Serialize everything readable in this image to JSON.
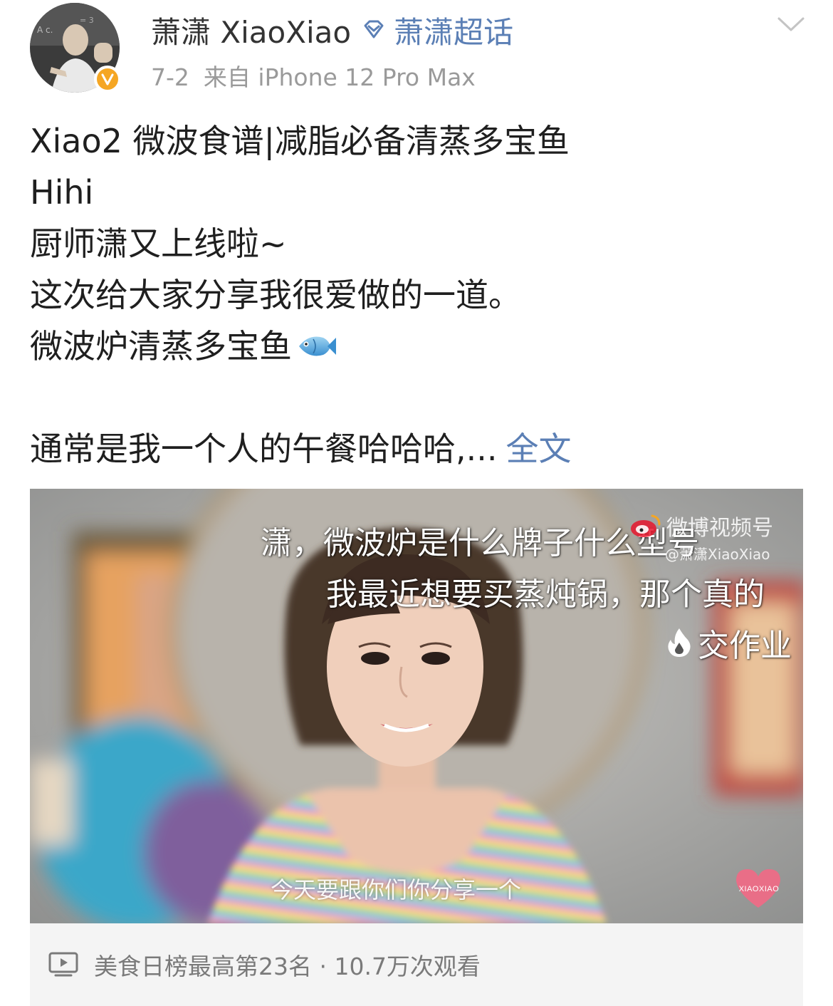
{
  "header": {
    "username": "萧潇 XiaoXiao",
    "supertopic_label": "萧潇超话",
    "date": "7-2",
    "source": "来自 iPhone 12 Pro Max",
    "avatar_icon": "avatar-photo",
    "verified_icon": "verified-v-badge",
    "verified_color": "#f5a623",
    "supertopic_icon": "diamond-icon",
    "link_color": "#5b7fb5"
  },
  "post": {
    "lines": [
      "Xiao2 微波食谱|减脂必备清蒸多宝鱼",
      "Hihi",
      "厨师潇又上线啦~",
      "这次给大家分享我很爱做的一道。",
      "微波炉清蒸多宝鱼"
    ],
    "emoji_icon": "fish-emoji",
    "truncated_line": "通常是我一个人的午餐哈哈哈,...",
    "fulltext_link": "全文"
  },
  "video": {
    "danmaku": [
      "潇，微波炉是什么牌子什么型号",
      "我最近想要买蒸炖锅，那个真的",
      "交作业"
    ],
    "watermark_title": "微博视频号",
    "watermark_user": "@萧潇XiaoXiao",
    "subtitle": "今天要跟你们你分享一个",
    "brand_label": "XIAOXIAO",
    "brand_color": "#f06a86"
  },
  "stats": {
    "icon": "video-play-icon",
    "text": "美食日榜最高第23名 · 10.7万次观看"
  }
}
